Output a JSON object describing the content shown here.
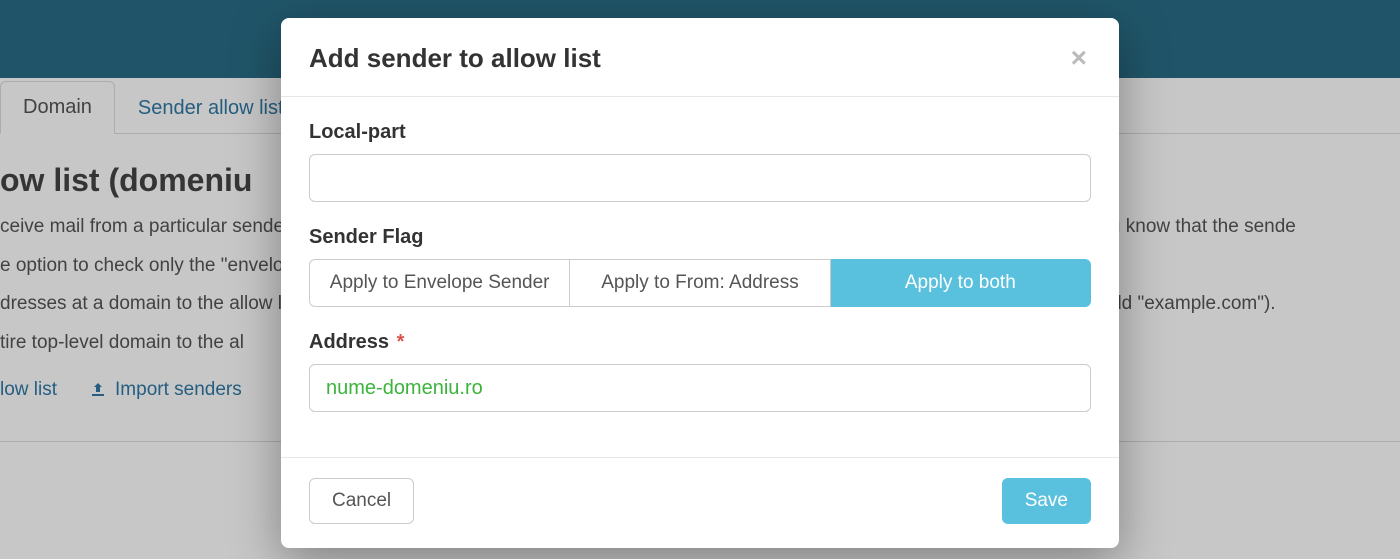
{
  "background": {
    "tabs": {
      "domain": "Domain",
      "allowlist": "Sender allow list"
    },
    "heading": "ow list (domeniu",
    "para1": "ceive mail from a particular sender, you can add an entry to the allow list so that mail will always be delivered. Only use this when you know that the sende",
    "para2a": "e option to check only the \"envelope sender\" address.",
    "para2b": "dresses at a domain to the allow list, leave the local part blank and enter only the domain (e.g., to add all senders at example.com, add \"example.com\").",
    "para2c": "tire top-level domain to the al",
    "actions": {
      "allowlist_link": "low list",
      "import_link": "Import senders"
    }
  },
  "modal": {
    "title": "Add sender to allow list",
    "labels": {
      "local_part": "Local-part",
      "sender_flag": "Sender Flag",
      "address": "Address"
    },
    "required_star": "*",
    "local_part_value": "",
    "sender_flag_options": {
      "envelope": "Apply to Envelope Sender",
      "from": "Apply to From: Address",
      "both": "Apply to both"
    },
    "address_value": "nume-domeniu.ro",
    "buttons": {
      "cancel": "Cancel",
      "save": "Save"
    }
  }
}
